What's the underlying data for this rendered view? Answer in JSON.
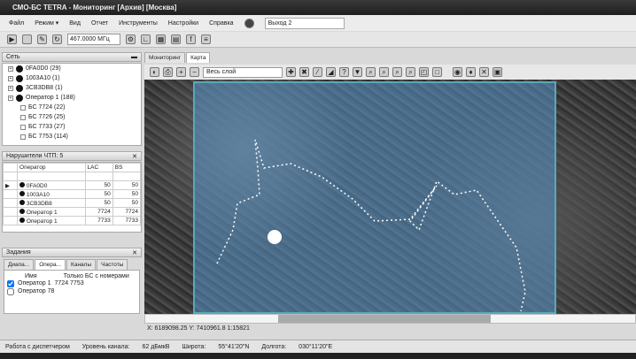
{
  "title": "СМО-БС TETRA - Мониторинг [Архив] [Москва]",
  "menu": [
    "Файл",
    "Режим ▾",
    "Вид",
    "Отчет",
    "Инструменты",
    "Настройки",
    "Справка"
  ],
  "output_select": "Выход 2",
  "frequency": "467.0000 МГц",
  "network": {
    "header": "Сеть",
    "items": [
      {
        "label": "0FA0D0 (29)",
        "level": 0
      },
      {
        "label": "1003A10 (1)",
        "level": 0
      },
      {
        "label": "3CB3DB8 (1)",
        "level": 0
      },
      {
        "label": "Оператор 1 (188)",
        "level": 0
      },
      {
        "label": "БС 7724 (22)",
        "level": 1
      },
      {
        "label": "БС 7726 (25)",
        "level": 1
      },
      {
        "label": "БС 7733 (27)",
        "level": 1
      },
      {
        "label": "БС 7753 (114)",
        "level": 1
      }
    ]
  },
  "violators": {
    "header": "Нарушители ЧТП: 5",
    "columns": [
      "Оператор",
      "LAC",
      "BS"
    ],
    "rows": [
      [
        "0FA0D0",
        "50",
        "50"
      ],
      [
        "1003A10",
        "50",
        "50"
      ],
      [
        "3CB3DB8",
        "50",
        "50"
      ],
      [
        "Оператор 1",
        "7724",
        "7724"
      ],
      [
        "Оператор 1",
        "7733",
        "7733"
      ]
    ]
  },
  "tasks": {
    "header": "Задания",
    "tabs": [
      "Диапа...",
      "Опера...",
      "Каналы",
      "Частоты"
    ],
    "columns": [
      "Имя",
      "Только БС с номерами"
    ],
    "rows": [
      {
        "name": "Оператор 1",
        "bs": "7724 7753",
        "checked": true
      },
      {
        "name": "Оператор 78",
        "bs": "",
        "checked": false
      }
    ]
  },
  "map": {
    "tabs": [
      "Мониторинг",
      "Карта"
    ],
    "layer_select": "Весь слой",
    "coords": "X: 6189098.25 Y: 7410961.8 1:15821"
  },
  "status": {
    "mode": "Работа с диспетчером",
    "level_label": "Уровень канала:",
    "level": "62 дБмкВ",
    "lat_label": "Широта:",
    "lat": "55°41'20\"N",
    "lon_label": "Долгота:",
    "lon": "030°11'20\"E"
  }
}
